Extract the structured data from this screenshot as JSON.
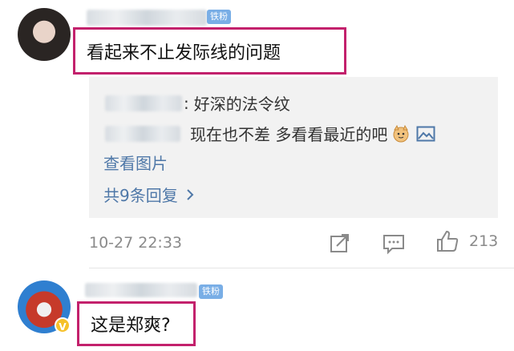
{
  "comments": [
    {
      "username": "",
      "badge": "铁粉",
      "text": "看起来不止发际线的问题",
      "replies": [
        {
          "author_suffix": ":",
          "text": "好深的法令纹"
        },
        {
          "author_suffix": "",
          "text": "现在也不差 多看看最近的吧"
        }
      ],
      "view_image_label": "查看图片",
      "more_replies_label": "共9条回复",
      "timestamp": "10-27 22:33",
      "like_count": "213"
    },
    {
      "username": "",
      "badge": "铁粉",
      "text": "这是郑爽?"
    }
  ],
  "colors": {
    "highlight_border": "#c3216c",
    "link": "#4f78a8",
    "badge_bg": "#79aee6",
    "reply_bg": "#f2f2f2",
    "verified": "#f6c12a"
  },
  "icons": [
    "share-icon",
    "comment-icon",
    "like-icon",
    "image-icon",
    "cat-emoji-icon",
    "verified-icon"
  ]
}
